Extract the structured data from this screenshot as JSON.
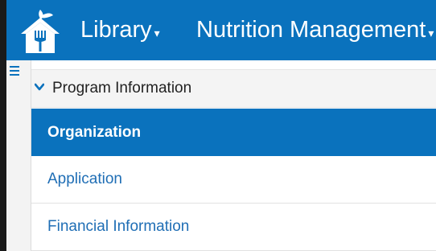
{
  "colors": {
    "primary": "#0a72bd",
    "link": "#1f6eb5",
    "header_bg": "#f4f4f4"
  },
  "topbar": {
    "logo_icon": "house-fork-leaf-icon",
    "menus": [
      {
        "label": "Library",
        "caret": "▾"
      },
      {
        "label": "Nutrition Management",
        "caret": "▾"
      }
    ]
  },
  "sidebar": {
    "toggle_icon": "hamburger-icon",
    "section": {
      "title": "Program Information",
      "expanded": true,
      "chevron_icon": "chevron-down-icon",
      "items": [
        {
          "label": "Organization",
          "active": true
        },
        {
          "label": "Application",
          "active": false
        },
        {
          "label": "Financial Information",
          "active": false
        }
      ]
    }
  }
}
